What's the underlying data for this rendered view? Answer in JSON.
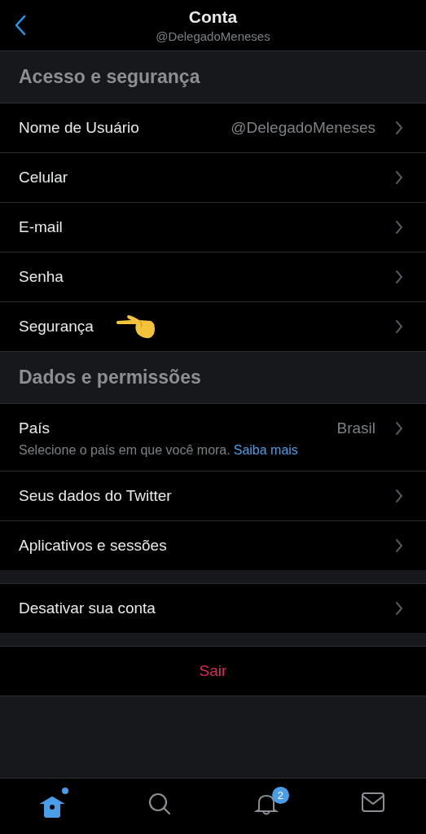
{
  "header": {
    "title": "Conta",
    "subtitle": "@DelegadoMeneses"
  },
  "sections": [
    {
      "title": "Acesso e segurança",
      "rows": [
        {
          "label": "Nome de Usuário",
          "value": "@DelegadoMeneses",
          "pointer": false
        },
        {
          "label": "Celular",
          "pointer": false
        },
        {
          "label": "E-mail",
          "pointer": false
        },
        {
          "label": "Senha",
          "pointer": false
        },
        {
          "label": "Segurança",
          "pointer": true
        }
      ]
    },
    {
      "title": "Dados e permissões",
      "rows": [
        {
          "label": "País",
          "value": "Brasil",
          "note": "Selecione o país em que você mora.",
          "note_link": "Saiba mais",
          "pointer": false
        },
        {
          "label": "Seus dados do Twitter",
          "pointer": false
        },
        {
          "label": "Aplicativos e sessões",
          "pointer": false
        }
      ]
    },
    {
      "rows": [
        {
          "label": "Desativar sua conta",
          "pointer": false
        }
      ]
    }
  ],
  "logout": "Sair",
  "tabs": [
    {
      "kind": "home",
      "selected": true,
      "dot": true
    },
    {
      "kind": "search",
      "selected": false,
      "dot": false
    },
    {
      "kind": "notifications",
      "selected": false,
      "dot": false,
      "badge": "2"
    },
    {
      "kind": "messages",
      "selected": false,
      "dot": false
    }
  ]
}
